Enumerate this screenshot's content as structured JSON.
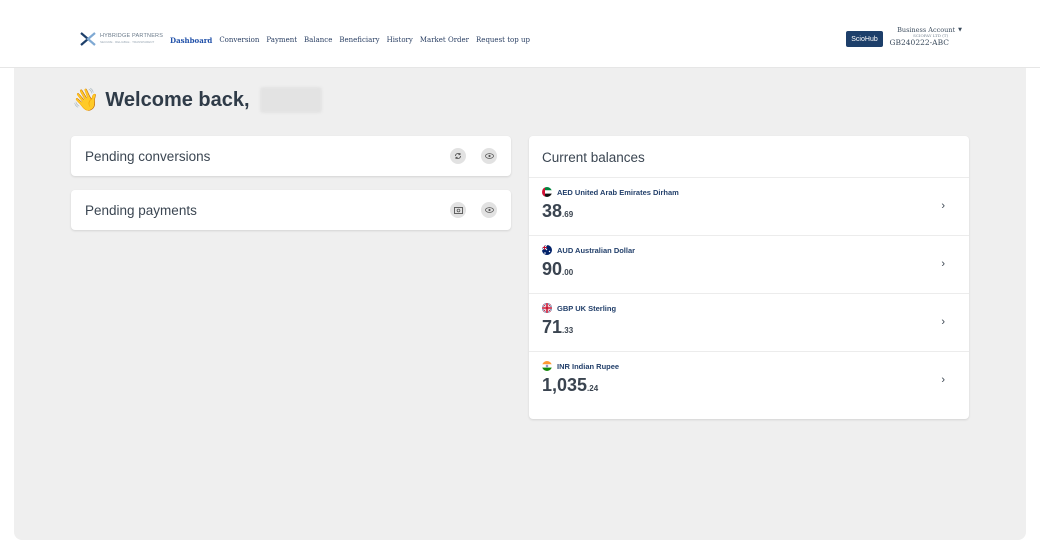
{
  "header": {
    "logo_name": "HYBRIDGE PARTNERS",
    "logo_sub": "SECURE · RELIABLE · TRANSPARENT",
    "nav": [
      "Dashboard",
      "Conversion",
      "Payment",
      "Balance",
      "Beneficiary",
      "History",
      "Market Order",
      "Request top up"
    ],
    "brand_badge": "ScioHub",
    "account_type": "Business Account",
    "account_company": "SCIOPAY LTD (T)",
    "account_id": "GB240222-ABC"
  },
  "welcome": {
    "emoji": "👋",
    "text": "Welcome back,"
  },
  "pending": {
    "conversions_title": "Pending conversions",
    "payments_title": "Pending payments"
  },
  "balances": {
    "title": "Current balances",
    "items": [
      {
        "code_name": "AED United Arab Emirates Dirham",
        "whole": "38",
        "decimal": ".69",
        "flag": "ae"
      },
      {
        "code_name": "AUD Australian Dollar",
        "whole": "90",
        "decimal": ".00",
        "flag": "au"
      },
      {
        "code_name": "GBP UK Sterling",
        "whole": "71",
        "decimal": ".33",
        "flag": "gb"
      },
      {
        "code_name": "INR Indian Rupee",
        "whole": "1,035",
        "decimal": ".24",
        "flag": "in"
      }
    ]
  }
}
